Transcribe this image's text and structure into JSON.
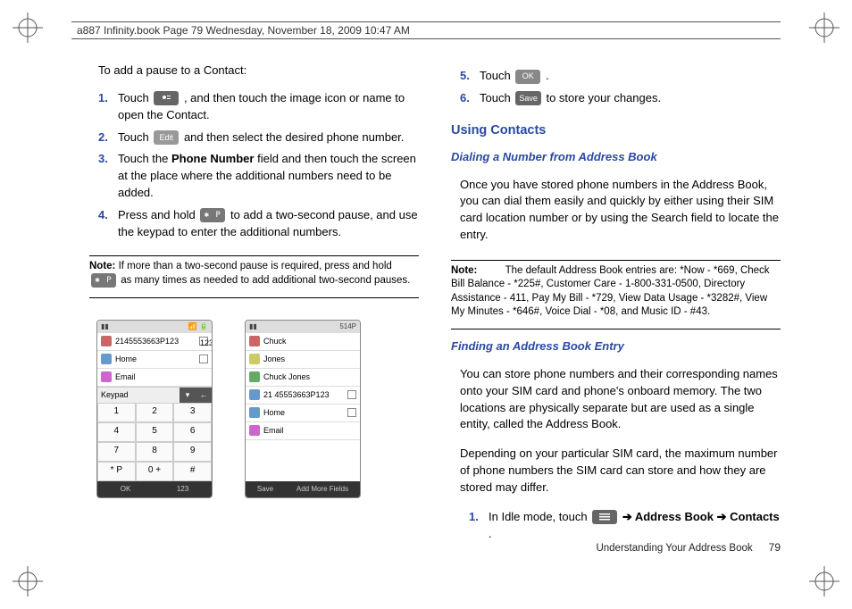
{
  "header": {
    "running": "a887 Infinity.book  Page 79  Wednesday, November 18, 2009  10:47 AM"
  },
  "left": {
    "lead": "To add a pause to a Contact:",
    "steps": [
      {
        "n": "1.",
        "pre": "Touch ",
        "btn": "",
        "post": ", and then touch the image icon or name to open the Contact."
      },
      {
        "n": "2.",
        "pre": "Touch ",
        "btn": "Edit",
        "post": " and then select the desired phone number."
      },
      {
        "n": "3.",
        "pre": "Touch the ",
        "bold": "Phone Number",
        "post": " field and then touch the screen at the place where the additional numbers need to be added."
      },
      {
        "n": "4.",
        "pre": "Press and hold ",
        "btn": "✱ P",
        "post": " to add a two-second pause, and use the keypad to enter the additional numbers."
      }
    ],
    "note": {
      "label": "Note:",
      "body_pre": "If more than a two-second pause is required, press and hold ",
      "btn": "✱ P",
      "body_post": " as many times as needed to add additional two-second pauses."
    },
    "shot1": {
      "top_num": "2145553663P123",
      "top_right": "123",
      "rows": [
        "Home",
        "Email"
      ],
      "kp_label": "Keypad",
      "keys": [
        "1",
        "2",
        "3",
        "4",
        "5",
        "6",
        "7",
        "8",
        "9",
        "* P",
        "0 +",
        "#"
      ],
      "foot": [
        "OK",
        "123"
      ]
    },
    "shot2": {
      "top_right": "514P",
      "rows": [
        "Chuck",
        "Jones",
        "Chuck Jones",
        "21 45553663P123",
        "Home",
        "Email"
      ],
      "foot": [
        "Save",
        "Add More Fields"
      ]
    }
  },
  "right": {
    "steps": [
      {
        "n": "5.",
        "pre": "Touch ",
        "btn": "OK",
        "post": "."
      },
      {
        "n": "6.",
        "pre": "Touch ",
        "btn": "Save",
        "post": " to store your changes."
      }
    ],
    "h2": "Using Contacts",
    "h3a": "Dialing a Number from Address Book",
    "p1": "Once you have stored phone numbers in the Address Book, you can dial them easily and quickly by either using their SIM card location number or by using the Search field to locate the entry.",
    "note": {
      "label": "Note:",
      "body": "The default Address Book entries are: *Now - *669, Check Bill Balance - *225#, Customer Care - 1-800-331-0500, Directory Assistance - 411, Pay My Bill - *729, View Data Usage - *3282#, View My Minutes - *646#, Voice Dial - *08, and Music ID - #43."
    },
    "h3b": "Finding an Address Book Entry",
    "p2": "You can store phone numbers and their corresponding names onto your SIM card and phone's onboard memory. The two locations are physically separate but are used as a single entity, called the Address Book.",
    "p3": "Depending on your particular SIM card, the maximum number of phone numbers the SIM card can store and how they are stored may differ.",
    "step1": {
      "n": "1.",
      "pre": "In Idle mode, touch ",
      "post1": " ➔ ",
      "b1": "Address Book",
      "post2": " ➔ ",
      "b2": "Contacts",
      "post3": "."
    }
  },
  "footer": {
    "section": "Understanding Your Address Book",
    "page": "79"
  }
}
